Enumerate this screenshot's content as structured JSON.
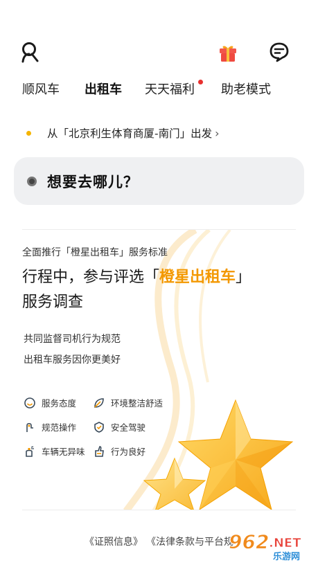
{
  "topbar": {
    "user_icon": "user-icon",
    "gift_icon": "gift-icon",
    "message_icon": "message-icon"
  },
  "tabs": [
    {
      "label": "顺风车",
      "active": false,
      "badge": false
    },
    {
      "label": "出租车",
      "active": true,
      "badge": false
    },
    {
      "label": "天天福利",
      "active": false,
      "badge": true
    },
    {
      "label": "助老模式",
      "active": false,
      "badge": false
    }
  ],
  "origin": {
    "text": "从「北京利生体育商厦-南门」出发",
    "dot_color": "#f5b400"
  },
  "destination": {
    "placeholder": "想要去哪儿？"
  },
  "banner": {
    "subtitle": "全面推行「橙星出租车」服务标准",
    "title_prefix": "行程中，参与评选「",
    "title_brand": "橙星出租车",
    "title_suffix": "」",
    "title_line2": "服务调查",
    "highlight1": "共同监督司机行为规范",
    "highlight2": "出租车服务因你更美好",
    "features": [
      {
        "label": "服务态度",
        "icon": "smile-icon"
      },
      {
        "label": "环境整洁舒适",
        "icon": "leaf-icon"
      },
      {
        "label": "规范操作",
        "icon": "hand-icon"
      },
      {
        "label": "安全驾驶",
        "icon": "shield-icon"
      },
      {
        "label": "车辆无异味",
        "icon": "spray-icon"
      },
      {
        "label": "行为良好",
        "icon": "thumb-icon"
      }
    ],
    "brand_color": "#f39800"
  },
  "footer": {
    "link1": "《证照信息》",
    "link2": "《法律条款与平台规"
  },
  "watermark": {
    "number": "962",
    "suffix": ".NET",
    "sub": "乐游网"
  }
}
